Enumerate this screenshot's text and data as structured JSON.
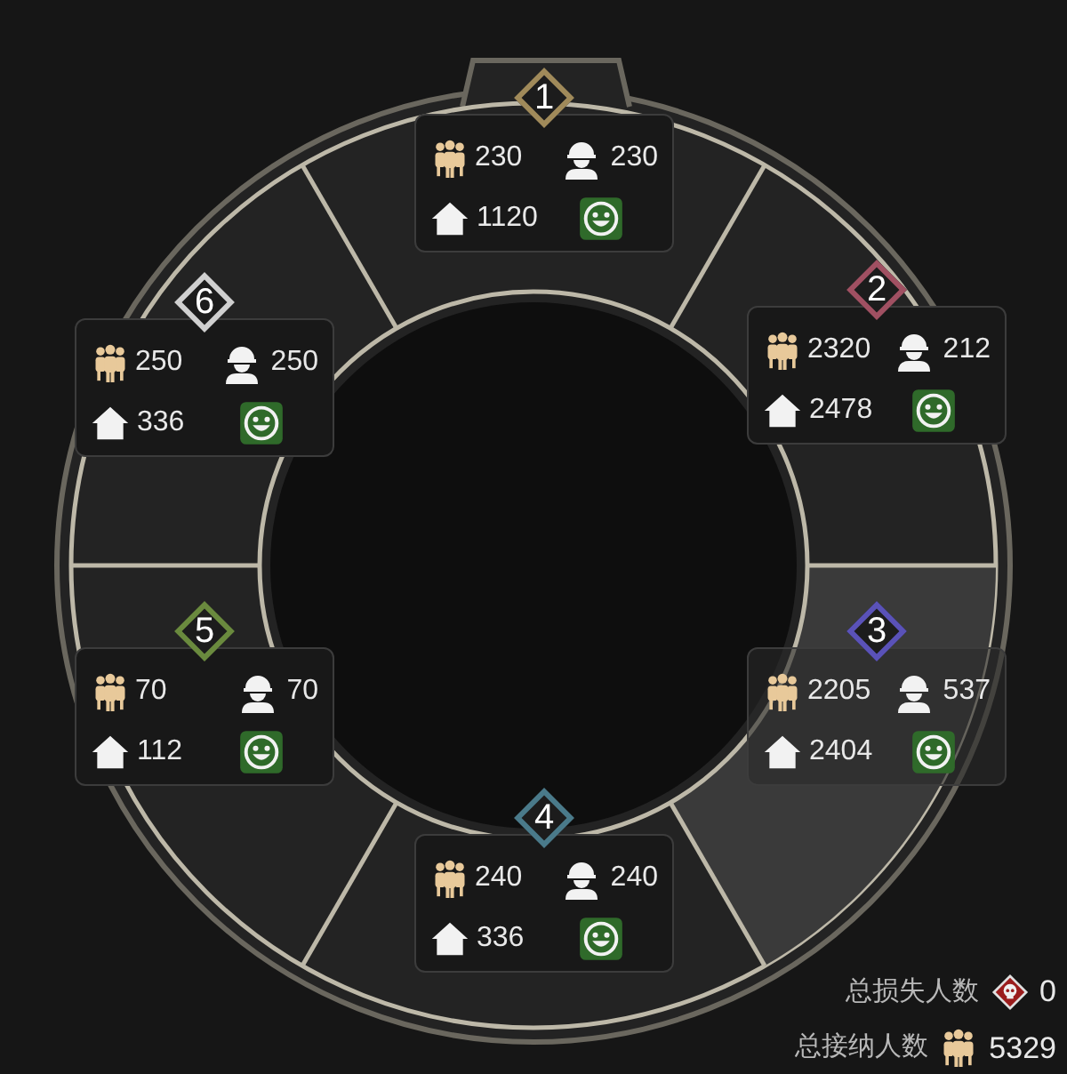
{
  "sectors": [
    {
      "number": "1",
      "color": "#a08a5a",
      "selected": false,
      "people": "230",
      "workers": "230",
      "housing": "1120"
    },
    {
      "number": "6",
      "color": "#d0d0d0",
      "selected": false,
      "people": "250",
      "workers": "250",
      "housing": "336"
    },
    {
      "number": "2",
      "color": "#a05062",
      "selected": false,
      "people": "2320",
      "workers": "212",
      "housing": "2478"
    },
    {
      "number": "5",
      "color": "#6a8a3e",
      "selected": false,
      "people": "70",
      "workers": "70",
      "housing": "112"
    },
    {
      "number": "3",
      "color": "#5a52b8",
      "selected": true,
      "people": "2205",
      "workers": "537",
      "housing": "2404"
    },
    {
      "number": "4",
      "color": "#4a7a8a",
      "selected": false,
      "people": "240",
      "workers": "240",
      "housing": "336"
    }
  ],
  "totals": {
    "lost_label": "总损失人数",
    "lost_value": "0",
    "accepted_label": "总接纳人数",
    "accepted_value": "5329"
  }
}
